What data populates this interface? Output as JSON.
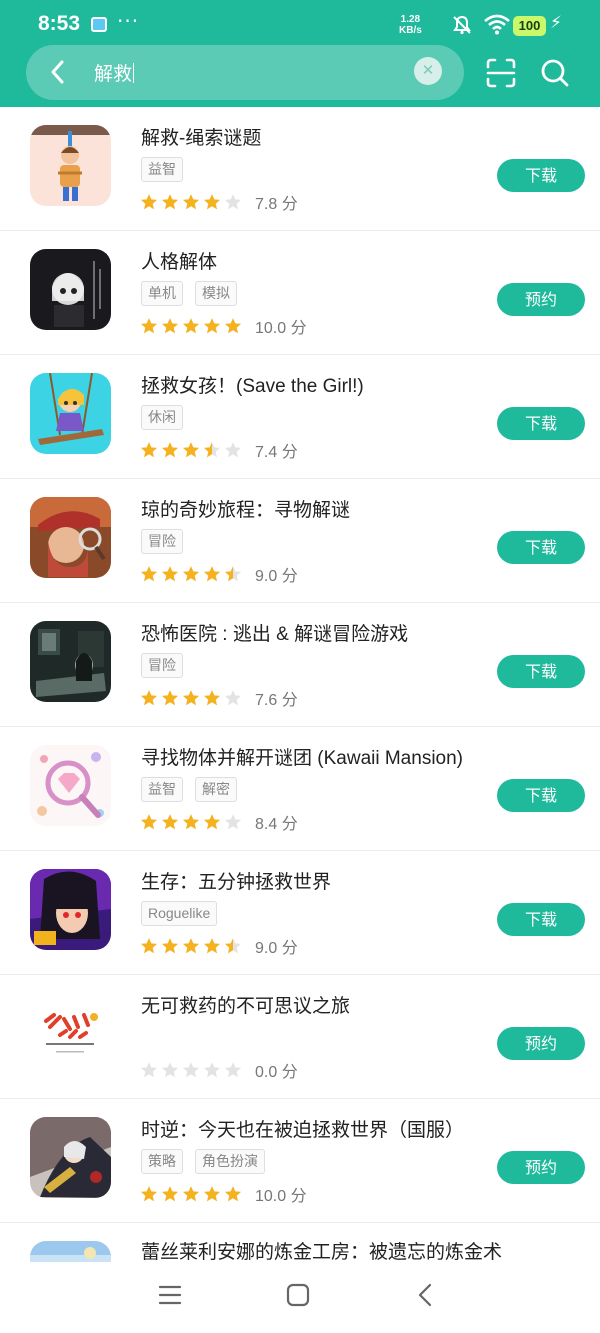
{
  "status_bar": {
    "time": "8:53",
    "dots": "···",
    "net_speed_value": "1.28",
    "net_speed_unit": "KB/s",
    "battery": "100"
  },
  "search": {
    "query": "解救",
    "back_icon": "chevron-left-icon",
    "clear_icon": "close-icon",
    "scan_icon": "scan-icon",
    "search_icon": "search-icon"
  },
  "colors": {
    "accent": "#1fb99c",
    "star_filled": "#f5b21e",
    "star_empty": "#e3e3e3"
  },
  "results": [
    {
      "name": "解救-绳索谜题",
      "tags": [
        "益智"
      ],
      "stars": 4,
      "score": "7.8 分",
      "action": "下载"
    },
    {
      "name": "人格解体",
      "tags": [
        "单机",
        "模拟"
      ],
      "stars": 5,
      "score": "10.0 分",
      "action": "预约"
    },
    {
      "name": "拯救女孩！(Save the Girl!)",
      "tags": [
        "休闲"
      ],
      "stars": 3.5,
      "score": "7.4 分",
      "action": "下载"
    },
    {
      "name": "琼的奇妙旅程：寻物解谜",
      "tags": [
        "冒险"
      ],
      "stars": 4.5,
      "score": "9.0 分",
      "action": "下载"
    },
    {
      "name": "恐怖医院 : 逃出 & 解谜冒险游戏",
      "tags": [
        "冒险"
      ],
      "stars": 4,
      "score": "7.6 分",
      "action": "下载"
    },
    {
      "name": "寻找物体并解开谜团 (Kawaii Mansion)",
      "tags": [
        "益智",
        "解密"
      ],
      "stars": 4,
      "score": "8.4 分",
      "action": "下载"
    },
    {
      "name": "生存：五分钟拯救世界",
      "tags": [
        "Roguelike"
      ],
      "stars": 4.5,
      "score": "9.0 分",
      "action": "下载"
    },
    {
      "name": "无可救药的不可思议之旅",
      "tags": [],
      "stars": 0,
      "score": "0.0 分",
      "action": "预约"
    },
    {
      "name": "时逆：今天也在被迫拯救世界（国服）",
      "tags": [
        "策略",
        "角色扮演"
      ],
      "stars": 5,
      "score": "10.0 分",
      "action": "预约"
    },
    {
      "name": "蕾丝莱利安娜的炼金工房：被遗忘的炼金术",
      "tags": [],
      "stars": null,
      "score": "",
      "action": ""
    }
  ],
  "nav_bar": {
    "menu_icon": "menu-icon",
    "home_icon": "home-icon",
    "back_icon": "back-icon"
  }
}
